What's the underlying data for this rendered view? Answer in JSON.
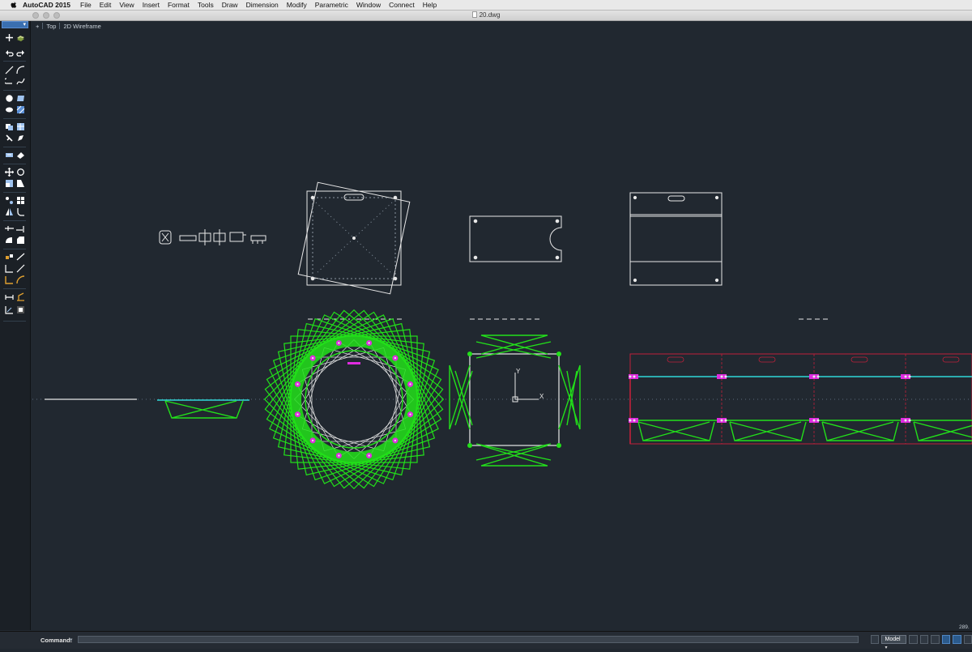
{
  "menubar": {
    "app_name": "AutoCAD 2015",
    "items": [
      "File",
      "Edit",
      "View",
      "Insert",
      "Format",
      "Tools",
      "Draw",
      "Dimension",
      "Modify",
      "Parametric",
      "Window",
      "Connect",
      "Help"
    ]
  },
  "window": {
    "title": "20.dwg"
  },
  "viewport": {
    "plus": "+",
    "view_name": "Top",
    "visual_style": "2D Wireframe"
  },
  "drawing": {
    "ucs_y_label": "Y",
    "ucs_x_label": "X",
    "colors": {
      "background": "#212830",
      "green": "#22e01a",
      "cyan": "#2fd8d8",
      "magenta": "#e02ce0",
      "red": "#c0203a",
      "white": "#e8e8e8"
    }
  },
  "command_line": {
    "label": "Command:"
  },
  "status_bar": {
    "coordinate_readout": "289.",
    "model_tab": "Model"
  }
}
